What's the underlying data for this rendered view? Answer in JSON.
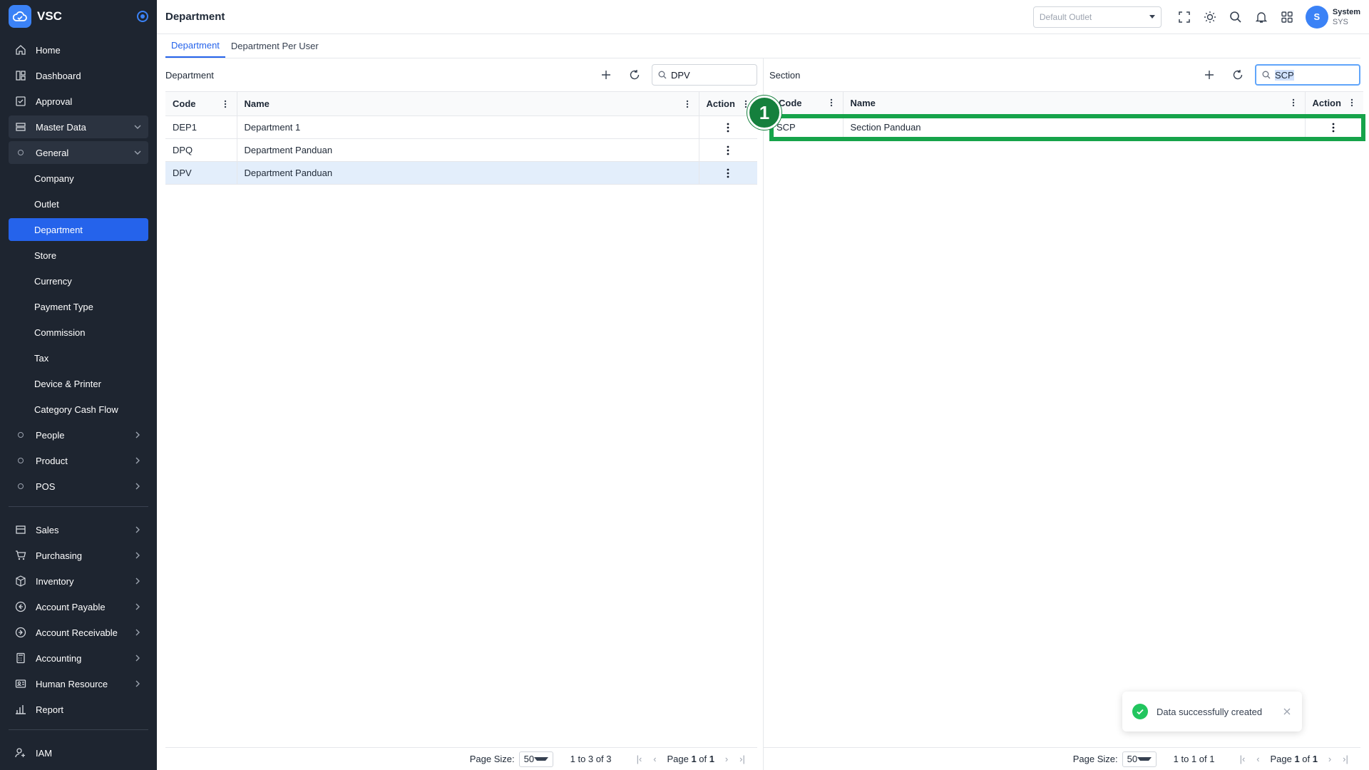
{
  "app": {
    "name": "VSC"
  },
  "sidebar": {
    "items": [
      {
        "label": "Home",
        "icon": "home-icon"
      },
      {
        "label": "Dashboard",
        "icon": "dashboard-icon"
      },
      {
        "label": "Approval",
        "icon": "approval-icon"
      }
    ],
    "master_data": {
      "label": "Master Data"
    },
    "general": {
      "label": "General"
    },
    "general_items": [
      {
        "label": "Company"
      },
      {
        "label": "Outlet"
      },
      {
        "label": "Department",
        "active": true
      },
      {
        "label": "Store"
      },
      {
        "label": "Currency"
      },
      {
        "label": "Payment Type"
      },
      {
        "label": "Commission"
      },
      {
        "label": "Tax"
      },
      {
        "label": "Device & Printer"
      },
      {
        "label": "Category Cash Flow"
      }
    ],
    "sub_groups": [
      {
        "label": "People"
      },
      {
        "label": "Product"
      },
      {
        "label": "POS"
      }
    ],
    "modules": [
      {
        "label": "Sales",
        "icon": "sales-icon"
      },
      {
        "label": "Purchasing",
        "icon": "cart-icon"
      },
      {
        "label": "Inventory",
        "icon": "box-icon"
      },
      {
        "label": "Account Payable",
        "icon": "arrow-left-circle-icon"
      },
      {
        "label": "Account Receivable",
        "icon": "arrow-right-circle-icon"
      },
      {
        "label": "Accounting",
        "icon": "calculator-icon"
      },
      {
        "label": "Human Resource",
        "icon": "id-card-icon"
      },
      {
        "label": "Report",
        "icon": "bar-chart-icon"
      }
    ],
    "iam": {
      "label": "IAM"
    }
  },
  "topbar": {
    "title": "Department",
    "outlet_placeholder": "Default Outlet",
    "user": {
      "initial": "S",
      "name": "System",
      "code": "SYS"
    }
  },
  "tabs": [
    {
      "label": "Department",
      "active": true
    },
    {
      "label": "Department Per User",
      "active": false
    }
  ],
  "department_panel": {
    "title": "Department",
    "search_value": "DPV",
    "columns": {
      "code": "Code",
      "name": "Name",
      "action": "Action"
    },
    "rows": [
      {
        "code": "DEP1",
        "name": "Department 1"
      },
      {
        "code": "DPQ",
        "name": "Department Panduan"
      },
      {
        "code": "DPV",
        "name": "Department Panduan"
      }
    ],
    "footer": {
      "page_size_label": "Page Size:",
      "page_size": "50",
      "range": "1 to 3 of 3",
      "page_label": "Page",
      "page": "1",
      "of_label": "of",
      "total_pages": "1"
    }
  },
  "section_panel": {
    "title": "Section",
    "search_value": "SCP",
    "columns": {
      "code": "Code",
      "name": "Name",
      "action": "Action"
    },
    "rows": [
      {
        "code": "SCP",
        "name": "Section Panduan"
      }
    ],
    "marker": "1",
    "footer": {
      "page_size_label": "Page Size:",
      "page_size": "50",
      "range": "1 to 1 of 1",
      "page_label": "Page",
      "page": "1",
      "of_label": "of",
      "total_pages": "1"
    }
  },
  "toast": {
    "message": "Data successfully created"
  },
  "colors": {
    "sidebar_bg": "#1e2530",
    "accent": "#2563eb",
    "highlight": "#16a34a",
    "success": "#22c55e"
  }
}
